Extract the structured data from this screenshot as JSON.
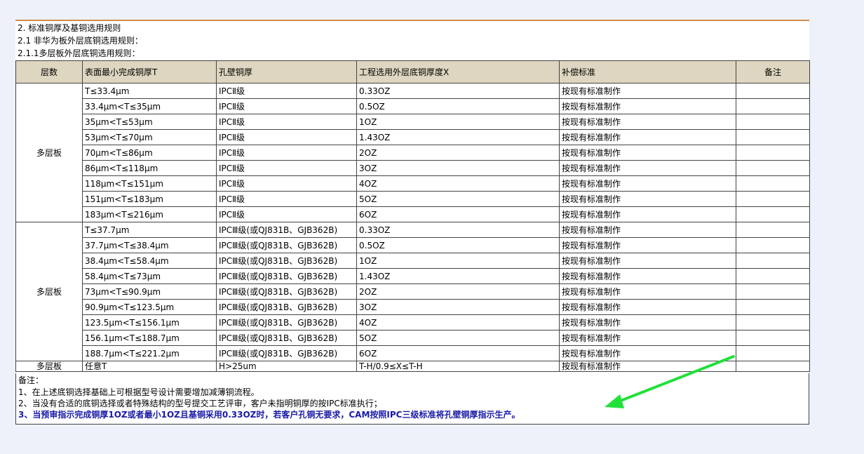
{
  "headings": [
    "2. 标准铜厚及基铜选用规则",
    "2.1 非华为板外层底铜选用规则：",
    "2.1.1多层板外层底铜选用规则："
  ],
  "table": {
    "columns": [
      "层数",
      "表面最小完成铜厚T",
      "孔壁铜厚",
      "工程选用外层底铜厚度X",
      "补偿标准",
      "备注"
    ],
    "group1": {
      "layer": "多层板",
      "rows": [
        [
          "T≤33.4μm",
          "IPCⅡ级",
          "0.33OZ",
          "按现有标准制作",
          ""
        ],
        [
          "33.4μm<T≤35μm",
          "IPCⅡ级",
          "0.5OZ",
          "按现有标准制作",
          ""
        ],
        [
          "35μm<T≤53μm",
          "IPCⅡ级",
          "1OZ",
          "按现有标准制作",
          ""
        ],
        [
          "53μm<T≤70μm",
          "IPCⅡ级",
          "1.43OZ",
          "按现有标准制作",
          ""
        ],
        [
          "70μm<T≤86μm",
          "IPCⅡ级",
          "2OZ",
          "按现有标准制作",
          ""
        ],
        [
          "86μm<T≤118μm",
          "IPCⅡ级",
          "3OZ",
          "按现有标准制作",
          ""
        ],
        [
          "118μm<T≤151μm",
          "IPCⅡ级",
          "4OZ",
          "按现有标准制作",
          ""
        ],
        [
          "151μm<T≤183μm",
          "IPCⅡ级",
          "5OZ",
          "按现有标准制作",
          ""
        ],
        [
          "183μm<T≤216μm",
          "IPCⅡ级",
          "6OZ",
          "按现有标准制作",
          ""
        ]
      ]
    },
    "group2": {
      "layer": "多层板",
      "rows": [
        [
          "T≤37.7μm",
          "IPCⅢ级(或QJ831B、GJB362B)",
          "0.33OZ",
          "按现有标准制作",
          ""
        ],
        [
          "37.7μm<T≤38.4μm",
          "IPCⅢ级(或QJ831B、GJB362B)",
          "0.5OZ",
          "按现有标准制作",
          ""
        ],
        [
          "38.4μm<T≤58.4μm",
          "IPCⅢ级(或QJ831B、GJB362B)",
          "1OZ",
          "按现有标准制作",
          ""
        ],
        [
          "58.4μm<T≤73μm",
          "IPCⅢ级(或QJ831B、GJB362B)",
          "1.43OZ",
          "按现有标准制作",
          ""
        ],
        [
          "73μm<T≤90.9μm",
          "IPCⅢ级(或QJ831B、GJB362B)",
          "2OZ",
          "按现有标准制作",
          ""
        ],
        [
          "90.9μm<T≤123.5μm",
          "IPCⅢ级(或QJ831B、GJB362B)",
          "3OZ",
          "按现有标准制作",
          ""
        ],
        [
          "123.5μm<T≤156.1μm",
          "IPCⅢ级(或QJ831B、GJB362B)",
          "4OZ",
          "按现有标准制作",
          ""
        ],
        [
          "156.1μm<T≤188.7μm",
          "IPCⅢ级(或QJ831B、GJB362B)",
          "5OZ",
          "按现有标准制作",
          ""
        ],
        [
          "188.7μm<T≤221.2μm",
          "IPCⅢ级(或QJ831B、GJB362B)",
          "6OZ",
          "按现有标准制作",
          ""
        ]
      ]
    },
    "group3": {
      "layer": "多层板",
      "row": [
        "任意T",
        "H>25um",
        "T-H/0.9≤X≤T-H",
        "按现有标准制作",
        ""
      ]
    }
  },
  "notes": {
    "title": "备注：",
    "items": [
      "1、在上述底铜选择基础上可根据型号设计需要增加减薄铜流程。",
      "2、当没有合适的底铜选择或者特殊结构的型号提交工艺评审，客户未指明铜厚的按IPC标准执行；",
      "3、当预审指示完成铜厚1OZ或者最小1OZ且基铜采用0.33OZ时，若客户孔铜无要求，CAM按照IPC三级标准将孔壁铜厚指示生产。"
    ],
    "emphasis_color": "#1a1aa8"
  },
  "annotation": {
    "arrow_color": "#22e03a"
  }
}
